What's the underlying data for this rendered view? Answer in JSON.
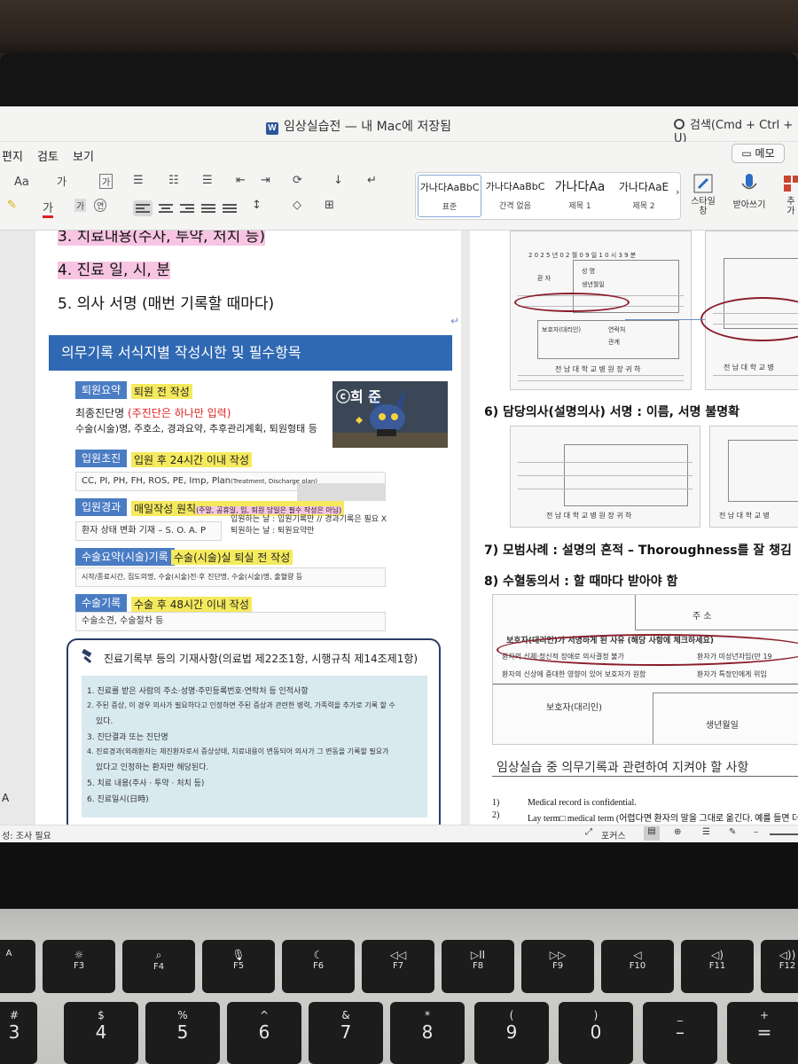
{
  "window": {
    "title": "임상실습전 — 내 Mac에 저장됨",
    "title_icon": "W",
    "search_label": "검색(Cmd + Ctrl + U)",
    "memo_label": "메모"
  },
  "ribbon_tabs": [
    "편지",
    "검토",
    "보기"
  ],
  "toolbar": {
    "font_size_label": "Aa",
    "styles": [
      {
        "preview": "가나다AaBbC",
        "name": "표준"
      },
      {
        "preview": "가나다AaBbC",
        "name": "간격 없음"
      },
      {
        "preview": "가나다Aa",
        "name": "제목 1"
      },
      {
        "preview": "가나다AaE",
        "name": "제목 2"
      }
    ],
    "styles_pane": "스타일\n창",
    "dictate": "받아쓰기",
    "addins": "추\n가"
  },
  "left_page": {
    "list_items": [
      "3. 치료내용(수사, 투약, 처치 등)",
      "4. 진료 일, 시, 분",
      "5. 의사 서명 (매번 기록할 때마다)"
    ],
    "banner": "의무기록 서식지별 작성시한 및 필수항목",
    "sections": [
      {
        "label": "퇴원요약",
        "deadline": "퇴원 전 작성",
        "content_line1": "최종진단명",
        "content_note": "(주진단은 하나만 입력)",
        "content_line2": "수술(시술)명, 주호소, 경과요약, 추후관리계획, 퇴원형태  등"
      },
      {
        "label": "입원초진",
        "deadline": "입원 후 24시간 이내 작성",
        "content": "CC, PI, PH, FH, ROS, PE, Imp, Plan",
        "content_small": "(Treatment, Discharge plan)"
      },
      {
        "label": "입원경과",
        "deadline": "매일작성 원칙",
        "deadline_note": "(주말, 공휴일, 입, 퇴원 당일은 필수 작성은 아님)",
        "note1": "입원하는 날 : 입원기록만 // 경과기록은 필요 X",
        "note2": "퇴원하는 날 : 퇴원요약만",
        "content": "환자 상태 변화 기재 – S. O. A. P"
      },
      {
        "label": "수술요약(시술)기록",
        "deadline": "수술(시술)실 퇴실 전 작성",
        "content": "시작/종료시간, 집도의명, 수술(시술)전·후 진단명, 수술(시술)명, 출혈량 등"
      },
      {
        "label": "수술기록",
        "deadline": "수술 후 48시간 이내 작성",
        "content": "수술소견, 수술절차 등"
      }
    ],
    "watermark": "ⓒ희 준",
    "legal_title": "진료기록부 등의 기재사항(의료법 제22조1항, 시행규칙 제14조제1항)",
    "legal_items": [
      "1. 진료를 받은 사람의 주소·성명·주민등록번호·연락처 등 인적사항",
      "2. 주된 증상, 이 경우 의사가 필요하다고 인정하면 주된 증상과 관련한 병력, 가족력을 추가로 기록 할 수",
      "있다.",
      "3. 진단결과 또는 진단명",
      "4. 진료경과(외래환자는 재진환자로서 증상상태, 치료내용이 변동되어 의사가 그 변동을 기록할 필요가",
      "있다고 인정하는 환자만 해당된다.",
      "5. 치료 내용(주사 · 투약 · 처치 등)",
      "6. 진료일시(日時)"
    ],
    "edge_char": "A"
  },
  "right_page": {
    "form_caption": "전 남 대 학 교 병 원 장 귀 하",
    "form_caption2": "전 남 대 학 교 병",
    "form_year": "2 0 2 5  년  0 2  월  0 9  일  1 0  시  3 9  분",
    "form_labels": [
      "성 명",
      "생년월일",
      "환 자",
      "보호자(대리인)",
      "연락처",
      "관계"
    ],
    "heading6": "6)  담당의사(설명의사) 서명 : 이름, 서명 불명확",
    "heading7": "7)  모범사례 : 설명의 흔적 – Thoroughness를 잘 챙김",
    "heading8": "8)  수혈동의서 : 할 때마다 받아야 함",
    "form3_title": "주        소",
    "form3_line1": "보호자(대리인)가 서명하게 된 사유 (해당 사항에 체크하세요)",
    "form3_opt1": "환자의 신체·정신적 장애로 의사결정 불가",
    "form3_opt2": "환자가 미성년자임(만 19",
    "form3_opt3": "환자의 신상에 중대한 영향이 있어 보호자가 원함",
    "form3_opt4": "환자가 특정인에게 위임",
    "form3_guardian": "보호자(대리인)",
    "form3_birth": "생년월일",
    "subheading": "임상실습 중 의무기록과 관련하여 지켜야 할 사항",
    "rules": [
      {
        "num": "1)",
        "text": "Medical record is confidential."
      },
      {
        "num": "2)",
        "text": "Lay term□ medical term (어렵다면 환자의 말을 그대로 옮긴다. 예를 들면 더수"
      }
    ]
  },
  "statusbar": {
    "left_text": "성: 조사 필요",
    "focus_label": "포커스"
  },
  "keyboard": {
    "fn_row": [
      {
        "sym": "",
        "lbl": "A"
      },
      {
        "sym": "☼",
        "lbl": "F3"
      },
      {
        "sym": "⌕",
        "lbl": "F4"
      },
      {
        "sym": "🎙",
        "lbl": "F5"
      },
      {
        "sym": "☾",
        "lbl": "F6"
      },
      {
        "sym": "◁◁",
        "lbl": "F7"
      },
      {
        "sym": "▷II",
        "lbl": "F8"
      },
      {
        "sym": "▷▷",
        "lbl": "F9"
      },
      {
        "sym": "◁",
        "lbl": "F10"
      },
      {
        "sym": "◁)",
        "lbl": "F11"
      },
      {
        "sym": "◁))",
        "lbl": "F12"
      }
    ],
    "num_row": [
      {
        "sym": "#",
        "lbl": "3"
      },
      {
        "sym": "$",
        "lbl": "4"
      },
      {
        "sym": "%",
        "lbl": "5"
      },
      {
        "sym": "^",
        "lbl": "6"
      },
      {
        "sym": "&",
        "lbl": "7"
      },
      {
        "sym": "*",
        "lbl": "8"
      },
      {
        "sym": "(",
        "lbl": "9"
      },
      {
        "sym": ")",
        "lbl": "0"
      },
      {
        "sym": "_",
        "lbl": "–"
      },
      {
        "sym": "+",
        "lbl": "="
      }
    ]
  }
}
